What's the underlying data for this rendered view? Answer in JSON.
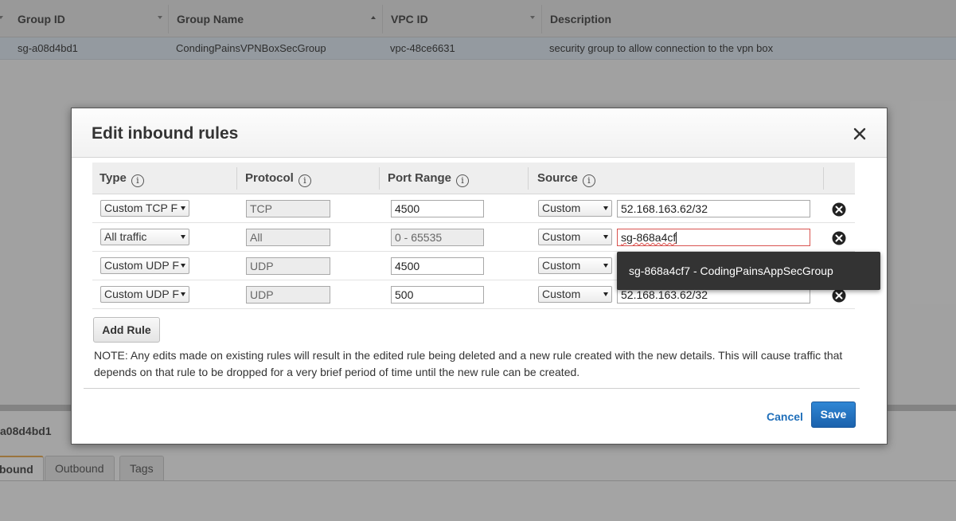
{
  "background": {
    "columns": [
      {
        "label": "Group ID"
      },
      {
        "label": "Group Name"
      },
      {
        "label": "VPC ID"
      },
      {
        "label": "Description"
      }
    ],
    "row": {
      "group_id": "sg-a08d4bd1",
      "group_name": "CondingPainsVPNBoxSecGroup",
      "vpc_id": "vpc-48ce6631",
      "description": "security group to allow connection to the vpn box"
    },
    "selected_group": "a08d4bd1",
    "tabs": [
      "bound",
      "Outbound",
      "Tags"
    ]
  },
  "modal": {
    "title": "Edit inbound rules",
    "columns": {
      "type": "Type",
      "protocol": "Protocol",
      "port_range": "Port Range",
      "source": "Source"
    },
    "info_glyph": "i",
    "rules": [
      {
        "type": "Custom TCP F",
        "protocol": "TCP",
        "port_range": "4500",
        "source_type": "Custom",
        "source_value": "52.168.163.62/32",
        "port_editable": true
      },
      {
        "type": "All traffic",
        "protocol": "All",
        "port_range": "0 - 65535",
        "source_type": "Custom",
        "source_value": "sg-868a4cf",
        "port_editable": false
      },
      {
        "type": "Custom UDP F",
        "protocol": "UDP",
        "port_range": "4500",
        "source_type": "Custom",
        "source_value": "",
        "port_editable": true
      },
      {
        "type": "Custom UDP F",
        "protocol": "UDP",
        "port_range": "500",
        "source_type": "Custom",
        "source_value": "52.168.163.62/32",
        "port_editable": true
      }
    ],
    "autocomplete": "sg-868a4cf7 - CodingPainsAppSecGroup",
    "add_rule_label": "Add Rule",
    "note": "NOTE: Any edits made on existing rules will result in the edited rule being deleted and a new rule created with the new details. This will cause traffic that depends on that rule to be dropped for a very brief period of time until the new rule can be created.",
    "cancel_label": "Cancel",
    "save_label": "Save"
  },
  "colors": {
    "primary_button": "#1f6fba",
    "error_border": "#d9534f",
    "active_tab_accent": "#e7a33e"
  }
}
